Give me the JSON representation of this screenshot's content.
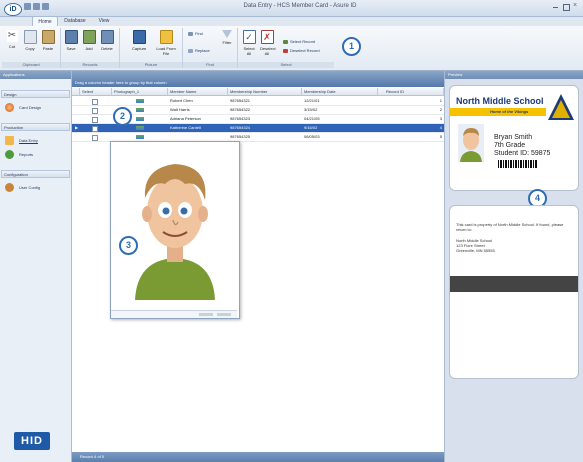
{
  "window": {
    "title": "Data Entry - HCS Member Card - Asure ID",
    "logo_text": "iD"
  },
  "tabs": [
    "Home",
    "Database",
    "View"
  ],
  "ribbon": {
    "groups": [
      {
        "label": "Clipboard",
        "buttons": [
          "Cut",
          "Copy",
          "Paste"
        ]
      },
      {
        "label": "Records",
        "buttons": [
          "Save",
          "Add",
          "Delete"
        ]
      },
      {
        "label": "Picture",
        "buttons": [
          "Capture",
          "Load From\nFile"
        ]
      },
      {
        "label": "Find",
        "buttons": [
          "Filter"
        ],
        "small": [
          "Find",
          "Replace"
        ]
      },
      {
        "label": "Select",
        "buttons": [
          "Select\nAll",
          "Deselect\nAll"
        ],
        "small": [
          "Select Record",
          "Deselect Record"
        ]
      }
    ]
  },
  "left_panel": {
    "header": "Applications",
    "sections": [
      {
        "title": "Design",
        "items": [
          {
            "label": "Card Design",
            "icon": "card-design-icon"
          }
        ]
      },
      {
        "title": "Production",
        "items": [
          {
            "label": "Data Entry",
            "icon": "data-entry-icon"
          },
          {
            "label": "Reports",
            "icon": "reports-icon"
          }
        ]
      },
      {
        "title": "Configuration",
        "items": [
          {
            "label": "User Config",
            "icon": "user-config-icon"
          }
        ]
      }
    ],
    "brand": "HID"
  },
  "grid": {
    "group_hint": "Drag a column header here to group by that column",
    "columns": [
      "Select",
      "Photograph_1",
      "Member Name",
      "Membership Number",
      "Membership Date",
      "Record ID"
    ],
    "rows": [
      {
        "name": "Robert Chen",
        "number": "987654321",
        "date": "12/21/01",
        "id": "1"
      },
      {
        "name": "Walt Harris",
        "number": "987654322",
        "date": "3/15/02",
        "id": "2"
      },
      {
        "name": "Adriana Peterson",
        "number": "987654323",
        "date": "04/21/05",
        "id": "3"
      },
      {
        "name": "Katherine Cardell",
        "number": "987654324",
        "date": "9/16/02",
        "id": "4"
      },
      {
        "name": "",
        "number": "987654325",
        "date": "06/05/03",
        "id": "5"
      }
    ],
    "selected_row": 3,
    "footer": "Record 4 of 5"
  },
  "card": {
    "panel_header": "Preview",
    "school": "North Middle School",
    "tagline": "Home of the Vikings",
    "student_name": "Bryan Smith",
    "grade": "7th Grade",
    "student_id": "Student ID: 59875",
    "back_text": "This card is property of North Middle School. If found, please return to:",
    "address": [
      "North Middle School",
      "123 Fiore Street",
      "Greenville, MN 55555"
    ]
  },
  "callouts": [
    "1",
    "2",
    "3",
    "4"
  ]
}
